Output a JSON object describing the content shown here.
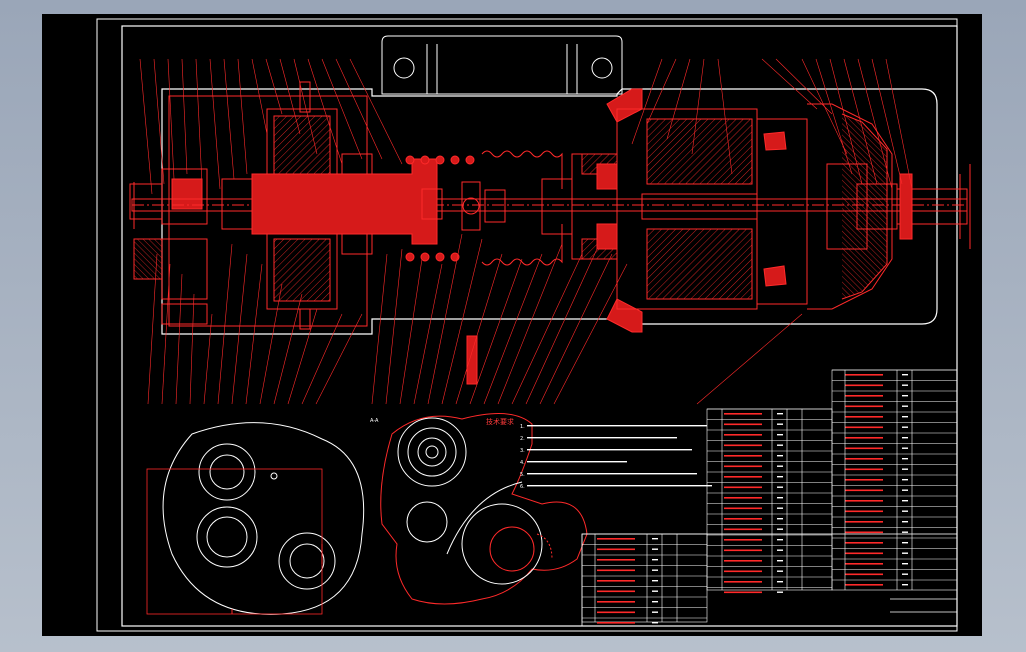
{
  "title_block": {
    "drawing_name": "",
    "notes_title": "技术要求",
    "header_cols": [
      "序号",
      "名称",
      "数量",
      "材料",
      "备注"
    ]
  },
  "notes": [
    "1.",
    "2.",
    "3.",
    "4.",
    "5.",
    "6."
  ],
  "section_mark": "A-A",
  "view_a_dims": {
    "width": "",
    "height": ""
  },
  "colors": {
    "line_red": "#ff2a2a",
    "line_white": "#ffffff",
    "fill_red": "#d61a1a",
    "background": "#000000",
    "desktop": "#a6b0c0"
  },
  "icons": {
    "window": "cad-drawing-viewport"
  }
}
